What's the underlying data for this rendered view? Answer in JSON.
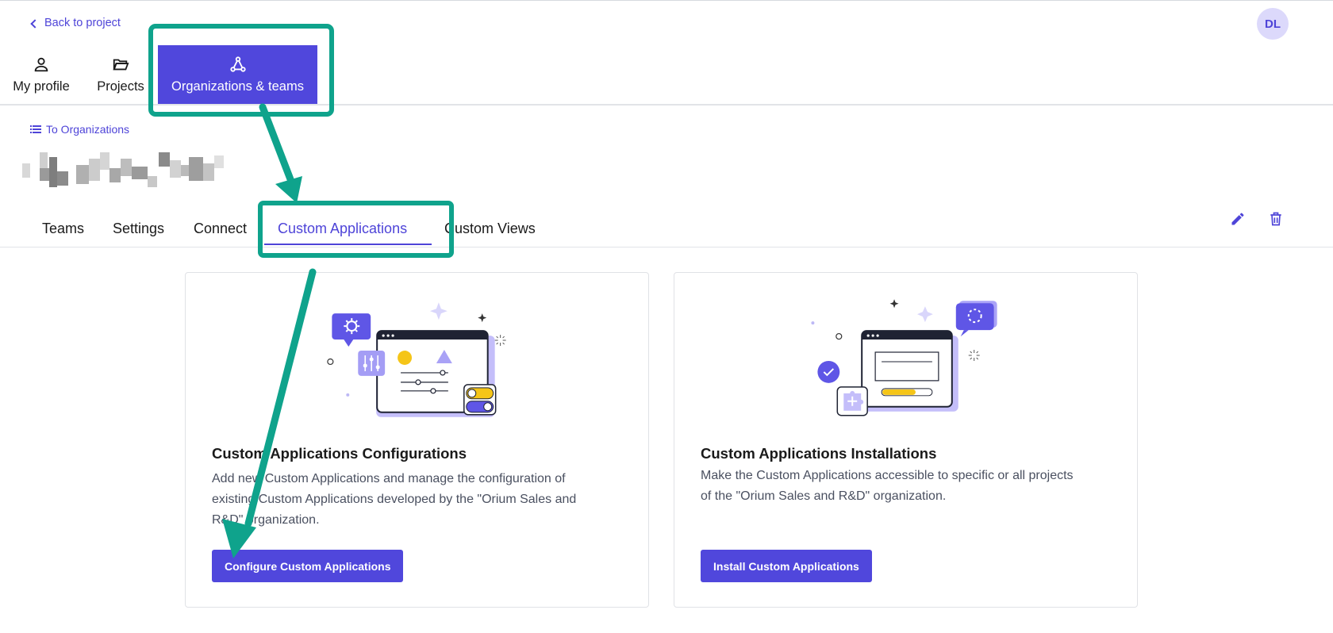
{
  "topbar": {
    "back_label": "Back to project",
    "avatar_initials": "DL"
  },
  "main_nav": {
    "items": [
      {
        "label": "My profile",
        "icon": "user-icon"
      },
      {
        "label": "Projects",
        "icon": "folder-open-icon"
      },
      {
        "label": "Organizations & teams",
        "icon": "organization-icon",
        "active": true
      }
    ]
  },
  "org": {
    "back_label": "To Organizations"
  },
  "tabs": [
    {
      "label": "Teams"
    },
    {
      "label": "Settings"
    },
    {
      "label": "Connect"
    },
    {
      "label": "Custom Applications",
      "active": true
    },
    {
      "label": "Custom Views"
    }
  ],
  "cards": [
    {
      "title": "Custom Applications Configurations",
      "line1": "Add new Custom Applications and manage the configuration of",
      "line2": "existing Custom Applications developed by the \"Orium Sales and",
      "line3": "R&D\" organization.",
      "button": "Configure Custom Applications"
    },
    {
      "title": "Custom Applications Installations",
      "line1": "Make the Custom Applications accessible to specific or all projects",
      "line2": "of the \"Orium Sales and R&D\" organization.",
      "button": "Install Custom Applications"
    }
  ],
  "colors": {
    "accent": "#5047dc",
    "annotation": "#0fa38c",
    "yellow": "#f5c518"
  }
}
